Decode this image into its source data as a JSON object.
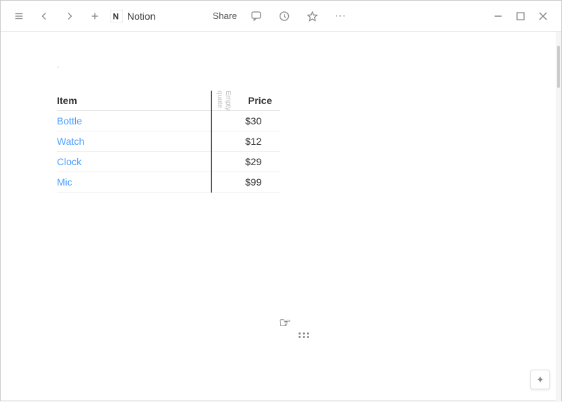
{
  "titlebar": {
    "brand": "Notion",
    "share_label": "Share",
    "menu_icon": "≡",
    "back_icon": "←",
    "forward_icon": "→",
    "plus_icon": "+",
    "minimize_icon": "—",
    "maximize_icon": "□",
    "close_icon": "✕",
    "more_icon": "···"
  },
  "table": {
    "col1_header": "Item",
    "col2_header": "Empty\nquote",
    "col3_header": "Price",
    "rows": [
      {
        "item": "Bottle",
        "price": "$30"
      },
      {
        "item": "Watch",
        "price": "$12"
      },
      {
        "item": "Clock",
        "price": "$29"
      },
      {
        "item": "Mic",
        "price": "$99"
      }
    ]
  },
  "corner_button_label": "✦",
  "dot": ".",
  "empty_col_text": "Empty quote"
}
